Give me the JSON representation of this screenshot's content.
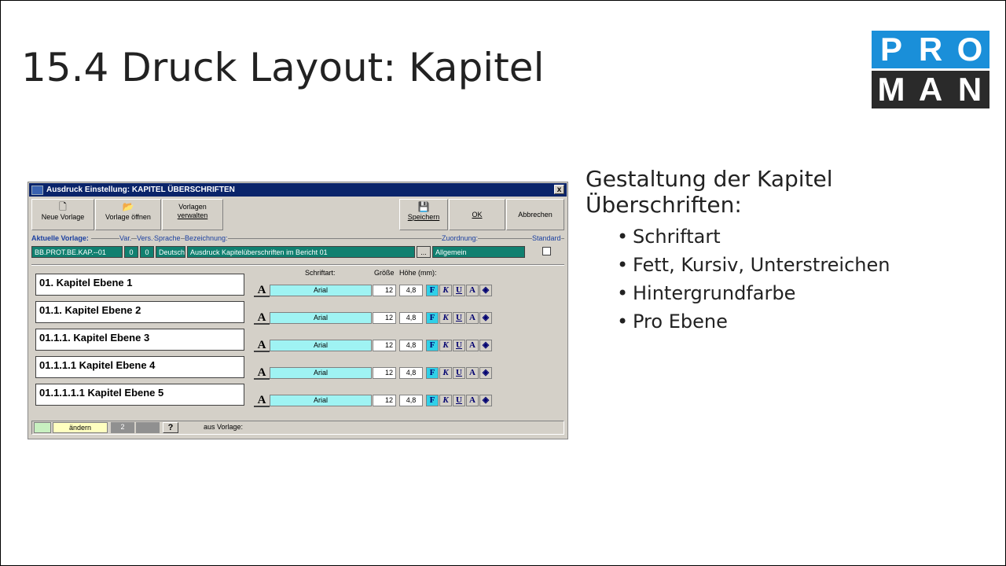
{
  "slide": {
    "title": "15.4 Druck Layout: Kapitel",
    "logo": {
      "top_letters": [
        "P",
        "R",
        "O"
      ],
      "bottom_letters": [
        "M",
        "A",
        "N"
      ],
      "top_color": "#1a8fd9",
      "bottom_color": "#2a2a2a"
    },
    "heading": "Gestaltung der Kapitel Überschriften:",
    "bullets": [
      "Schriftart",
      "Fett, Kursiv, Unterstreichen",
      "Hintergrundfarbe",
      "Pro Ebene"
    ]
  },
  "window": {
    "title": "Ausdruck Einstellung: KAPITEL ÜBERSCHRIFTEN",
    "close": "x",
    "toolbar": {
      "neue_vorlage": "Neue Vorlage",
      "vorlage_oeffnen": "Vorlage öffnen",
      "vorlagen_verwalten_1": "Vorlagen",
      "vorlagen_verwalten_2": "verwalten",
      "speichern": "Speichern",
      "ok": "OK",
      "abbrechen": "Abbrechen"
    },
    "labels": {
      "aktuelle_vorlage": "Aktuelle Vorlage:",
      "var": "Var.",
      "vers": "Vers.",
      "sprache": "Sprache",
      "bezeichnung": "Bezeichnung:",
      "zuordnung": "Zuordnung:",
      "standard": "Standard"
    },
    "fields": {
      "vorlage": "BB.PROT.BE.KAP.--01",
      "var": "0",
      "vers": "0",
      "sprache": "Deutsch",
      "bezeichnung": "Ausdruck Kapitelüberschriften im Bericht 01",
      "more": "...",
      "zuordnung": "Allgemein"
    },
    "columns": {
      "schriftart": "Schriftart:",
      "groesse": "Größe",
      "hoehe": "Höhe (mm):"
    },
    "levels": [
      {
        "label": "01. Kapitel Ebene 1",
        "font": "Arial",
        "size": "12",
        "height": "4,8"
      },
      {
        "label": "01.1. Kapitel Ebene 2",
        "font": "Arial",
        "size": "12",
        "height": "4,8"
      },
      {
        "label": "01.1.1. Kapitel Ebene 3",
        "font": "Arial",
        "size": "12",
        "height": "4,8"
      },
      {
        "label": "01.1.1.1 Kapitel Ebene 4",
        "font": "Arial",
        "size": "12",
        "height": "4,8"
      },
      {
        "label": "01.1.1.1.1 Kapitel Ebene 5",
        "font": "Arial",
        "size": "12",
        "height": "4,8"
      }
    ],
    "format_buttons": {
      "font_dialog": "A",
      "bold": "F",
      "italic": "K",
      "underline": "U",
      "color": "A",
      "fill": "◈"
    },
    "status": {
      "aendern": "ändern",
      "count": "2",
      "help": "?",
      "aus_vorlage": "aus Vorlage:"
    }
  }
}
